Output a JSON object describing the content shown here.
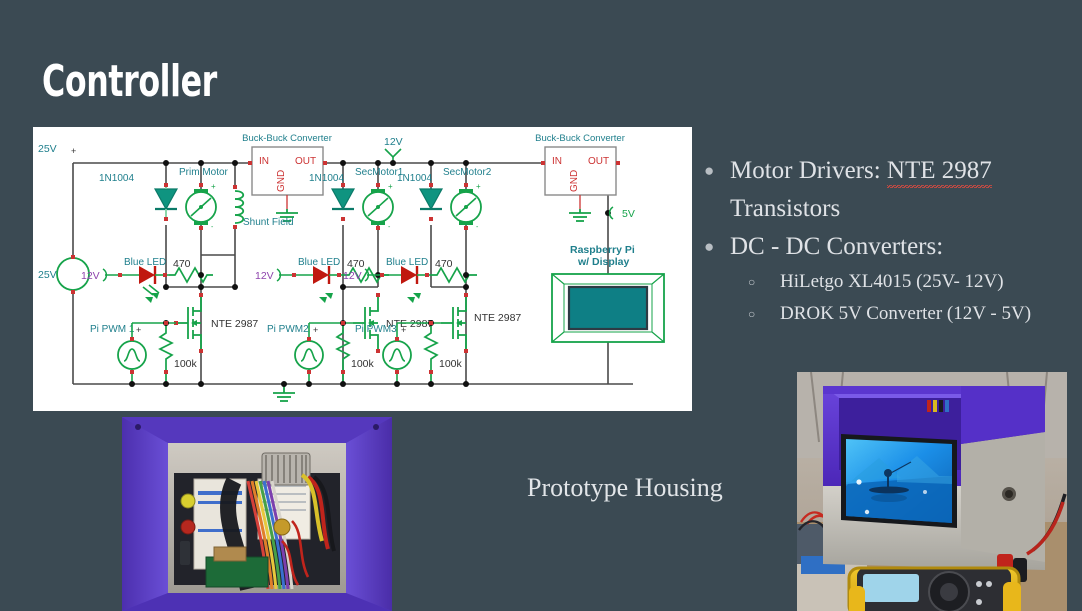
{
  "slide": {
    "title": "Controller",
    "background_color": "#3b4a53",
    "caption": "Prototype Housing"
  },
  "bullets": [
    {
      "marker": "●",
      "text_before": "Motor Drivers: ",
      "text_spellerror": "NTE 2987",
      "text_after": "",
      "line2": "Transistors"
    },
    {
      "marker": "●",
      "text_before": "DC - DC Converters:",
      "text_spellerror": "",
      "text_after": "",
      "line2": ""
    }
  ],
  "sub_bullets": [
    {
      "marker": "○",
      "text": "HiLetgo XL4015 (25V- 12V)"
    },
    {
      "marker": "○",
      "text": "DROK 5V Converter (12V - 5V)"
    }
  ],
  "circuit": {
    "canvas_color": "#ffffff",
    "label_color": "#1f7f8c",
    "wire_color": "#4a4a4a",
    "component_color": "#16a34a",
    "pin_color": "#cc3333",
    "labels": {
      "buck1": "Buck-Buck Converter",
      "buck2": "Buck-Buck Converter",
      "node_12v": "12V",
      "node_5v": "5V",
      "src_25v": "25V",
      "prim_motor": "Prim Motor",
      "shunt_field": "Shunt Field",
      "sec_motor1": "SecMotor1",
      "sec_motor2": "SecMotor2",
      "diode1": "1N1004",
      "diode2": "1N1004",
      "diode3": "1N1004",
      "rpi": "Raspberry Pi",
      "rpi2": "w/ Display",
      "led1": "Blue LED",
      "led2": "Blue LED",
      "led3": "Blue LED",
      "led_v1": "12V",
      "led_v2": "12V",
      "led_v3": "12V",
      "res1": "470",
      "res2": "470",
      "res3": "470",
      "mosfet1": "NTE 2987",
      "mosfet2": "NTE 2987",
      "mosfet3": "NTE 2987",
      "pwm1": "Pi PWM 1",
      "pwm2": "Pi PWM2",
      "pwm3": "Pi PWM3",
      "pull1": "100k",
      "pull2": "100k",
      "pull3": "100k",
      "conv_in": "IN",
      "conv_out": "OUT",
      "conv_gnd": "GND",
      "plus": "+"
    }
  },
  "photos": {
    "left": {
      "alt": "open purple 3d printed enclosure with breadboard wiring inside",
      "box_color": "#5b3fc4",
      "interior_color": "#b9b4ac"
    },
    "right": {
      "alt": "assembled enclosure with blue display screen and yellow multimeter",
      "box_top_color": "#5530c8",
      "box_body_color": "#c2c0bb",
      "screen_color": "#1f8fe0",
      "meter_color": "#e8b71b"
    }
  }
}
